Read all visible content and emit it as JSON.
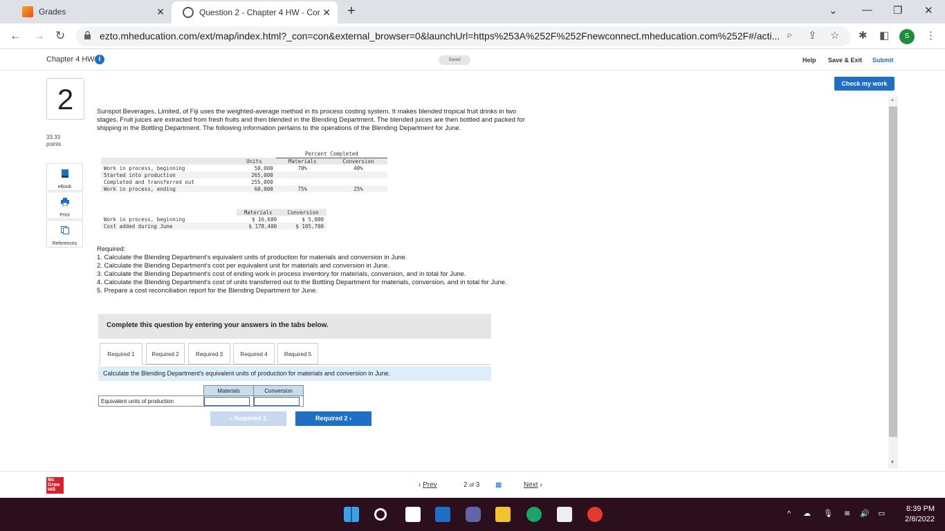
{
  "browser": {
    "tabs": [
      {
        "title": "Grades",
        "active": false
      },
      {
        "title": "Question 2 - Chapter 4 HW - Cor",
        "active": true
      }
    ],
    "url": "ezto.mheducation.com/ext/map/index.html?_con=con&external_browser=0&launchUrl=https%253A%252F%252Fnewconnect.mheducation.com%252F#/acti...",
    "profile_initial": "S"
  },
  "header": {
    "assignment_title": "Chapter 4 HW",
    "info_glyph": "i",
    "saved_label": "Saved",
    "help": "Help",
    "save_exit": "Save & Exit",
    "submit": "Submit"
  },
  "check_my_work": "Check my work",
  "question": {
    "number": "2",
    "points_value": "33.33",
    "points_label": "points",
    "resources": [
      "eBook",
      "Print",
      "References"
    ],
    "intro": "Sunspot Beverages, Limited, of Fiji uses the weighted-average method in its process costing system. It makes blended tropical fruit drinks in two stages. Fruit juices are extracted from fresh fruits and then blended in the Blending Department. The blended juices are then bottled and packed for shipping in the Bottling Department. The following information pertains to the operations of the Blending Department for June.",
    "units_table": {
      "group_header": "Percent Completed",
      "columns": [
        "Units",
        "Materials",
        "Conversion"
      ],
      "rows": [
        {
          "label": "Work in process, beginning",
          "units": "50,000",
          "materials": "70%",
          "conversion": "40%"
        },
        {
          "label": "Started into production",
          "units": "265,000",
          "materials": "",
          "conversion": ""
        },
        {
          "label": "Completed and transferred out",
          "units": "255,000",
          "materials": "",
          "conversion": ""
        },
        {
          "label": "Work in process, ending",
          "units": "60,000",
          "materials": "75%",
          "conversion": "25%"
        }
      ]
    },
    "cost_table": {
      "columns": [
        "Materials",
        "Conversion"
      ],
      "rows": [
        {
          "label": "Work in process, beginning",
          "materials": "$ 16,600",
          "conversion": "$ 5,000"
        },
        {
          "label": "Cost added during June",
          "materials": "$ 178,400",
          "conversion": "$ 105,700"
        }
      ]
    },
    "required_heading": "Required:",
    "required_items": [
      "1. Calculate the Blending Department's equivalent units of production for materials and conversion in June.",
      "2. Calculate the Blending Department's cost per equivalent unit for materials and conversion in June.",
      "3. Calculate the Blending Department's cost of ending work in process inventory for materials, conversion, and in total for June.",
      "4. Calculate the Blending Department's cost of units transferred out to the Bottling Department for materials, conversion, and in total for June.",
      "5. Prepare a cost reconciliation report for the Blending Department for June."
    ]
  },
  "answer_area": {
    "banner": "Complete this question by entering your answers in the tabs below.",
    "tabs": [
      "Required 1",
      "Required 2",
      "Required 3",
      "Required 4",
      "Required 5"
    ],
    "active_tab": 0,
    "instruction": "Calculate the Blending Department's equivalent units of production for materials and conversion in June.",
    "table": {
      "columns": [
        "Materials",
        "Conversion"
      ],
      "row_label": "Equivalent units of production",
      "materials_value": "",
      "conversion_value": ""
    },
    "prev_button": "Required 1",
    "next_button": "Required 2"
  },
  "footer": {
    "logo_lines": [
      "Mc",
      "Graw",
      "Hill"
    ],
    "prev": "Prev",
    "page_current": "2",
    "page_of": "of",
    "page_total": "3",
    "next": "Next"
  },
  "taskbar": {
    "time": "8:39 PM",
    "date": "2/8/2022"
  }
}
